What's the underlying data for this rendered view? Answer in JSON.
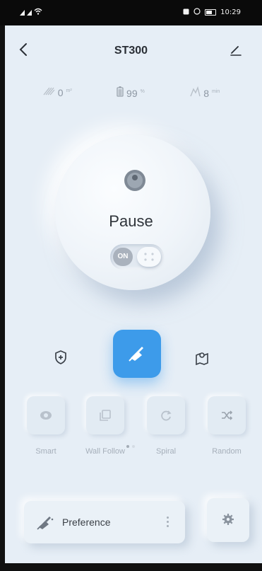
{
  "status_bar": {
    "time": "10:29",
    "icons": [
      "sim-signal-icon",
      "wifi-icon",
      "nfc-icon",
      "alarm-icon",
      "battery-icon"
    ]
  },
  "header": {
    "title": "ST300",
    "back_icon": "chevron-left-icon",
    "edit_icon": "pencil-icon"
  },
  "stats": [
    {
      "icon": "area-icon",
      "value": "0",
      "unit": "m²"
    },
    {
      "icon": "battery-icon",
      "value": "99",
      "unit": "%"
    },
    {
      "icon": "time-icon",
      "value": "8",
      "unit": "min"
    }
  ],
  "status_panel": {
    "state": "Pause",
    "toggle_label": "ON",
    "toggle_on": true
  },
  "actions": {
    "left_icon": "shield-icon",
    "center_icon": "clean-icon",
    "right_icon": "map-icon"
  },
  "modes": [
    {
      "label": "Smart",
      "icon": "eye-icon"
    },
    {
      "label": "Wall Follow",
      "icon": "wall-follow-icon"
    },
    {
      "label": "Spiral",
      "icon": "spiral-icon"
    },
    {
      "label": "Random",
      "icon": "random-icon"
    }
  ],
  "pagination": {
    "pages": 2,
    "current": 1
  },
  "preference": {
    "label": "Preference",
    "icon": "clean-icon"
  },
  "settings": {
    "icon": "gear-icon"
  },
  "colors": {
    "background": "#e6eef6",
    "accent": "#3d9bea",
    "text_primary": "#2a2f36",
    "text_muted": "#a6afba"
  }
}
